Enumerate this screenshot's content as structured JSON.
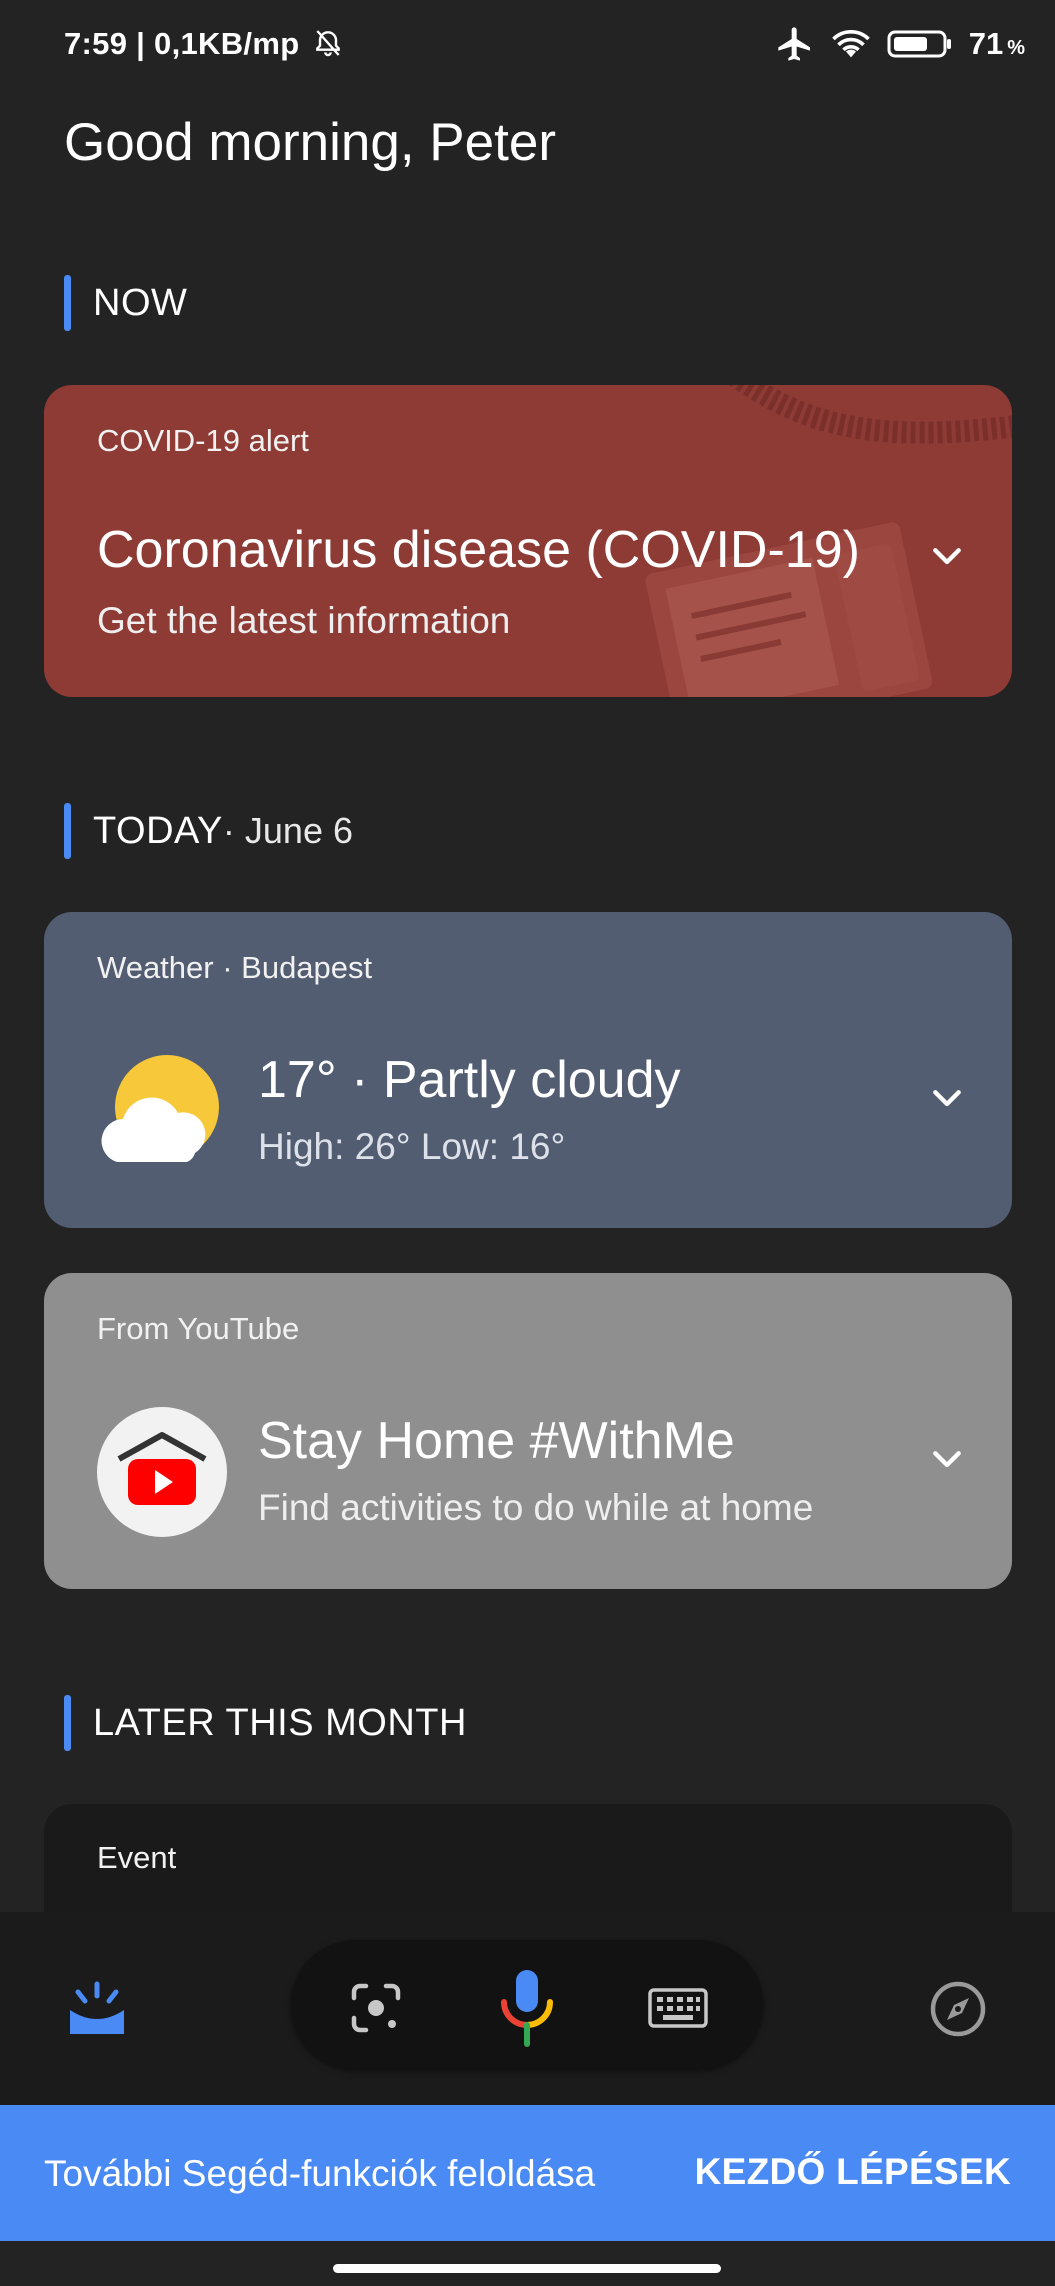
{
  "status_bar": {
    "time_speed": "7:59 | 0,1KB/mp",
    "battery_level": "71",
    "battery_unit": "%",
    "icons": [
      "alarm-off-icon",
      "airplane-icon",
      "wifi-icon",
      "battery-icon"
    ]
  },
  "greeting": "Good morning, Peter",
  "sections": {
    "now": {
      "label": "NOW"
    },
    "today": {
      "label": "TODAY",
      "date": " · June 6"
    },
    "later": {
      "label": "LATER THIS MONTH"
    }
  },
  "covid_card": {
    "kicker": "COVID-19 alert",
    "title": "Coronavirus disease (COVID-19)",
    "subtitle": "Get the latest information",
    "color": "#8e3b35"
  },
  "weather_card": {
    "kicker": "Weather · Budapest",
    "title": "17° · Partly cloudy",
    "subtitle": "High: 26° Low: 16°",
    "icon": "partly-cloudy-icon",
    "color": "#535d72"
  },
  "youtube_card": {
    "kicker": "From YouTube",
    "title": "Stay Home #WithMe",
    "subtitle": "Find activities to do while at home",
    "icon": "youtube-home-icon",
    "color": "#8f8f8f"
  },
  "event_card": {
    "kicker": "Event"
  },
  "bottom_nav": {
    "icons": [
      "snapshot-icon",
      "lens-icon",
      "mic-icon",
      "keyboard-icon",
      "compass-icon"
    ]
  },
  "banner": {
    "text": "További Segéd-funkciók feloldása",
    "action": "KEZDŐ LÉPÉSEK",
    "color": "#4a8af4"
  },
  "accent_color": "#4a8af4"
}
